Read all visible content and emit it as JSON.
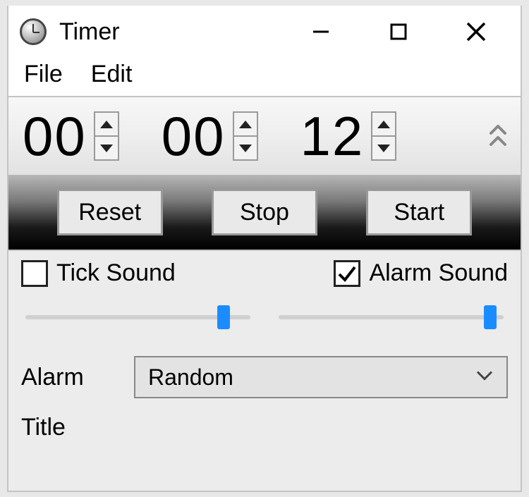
{
  "titlebar": {
    "title": "Timer"
  },
  "menu": {
    "file": "File",
    "edit": "Edit"
  },
  "time": {
    "hours": "00",
    "minutes": "00",
    "seconds": "12"
  },
  "controls": {
    "reset": "Reset",
    "stop": "Stop",
    "start": "Start"
  },
  "options": {
    "tick_sound_label": "Tick Sound",
    "tick_sound_checked": false,
    "alarm_sound_label": "Alarm Sound",
    "alarm_sound_checked": true,
    "tick_volume_pct": 88,
    "alarm_volume_pct": 94
  },
  "alarm": {
    "label": "Alarm",
    "selected": "Random"
  },
  "title_field": {
    "label": "Title",
    "value": ""
  }
}
